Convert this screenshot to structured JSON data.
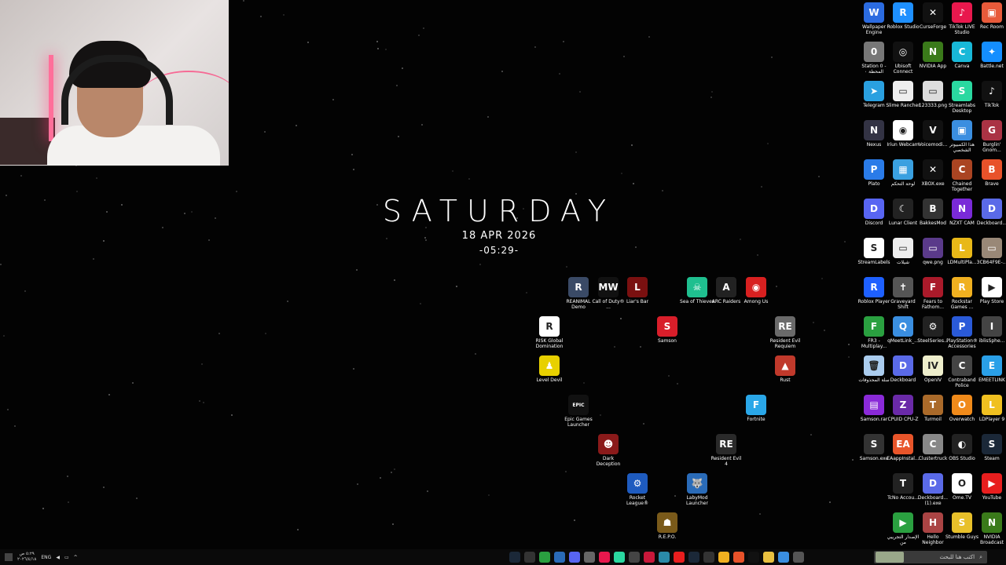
{
  "clock": {
    "day": "SATURDAY",
    "date": "18 APR 2026",
    "time": "-05:29-"
  },
  "taskbar": {
    "lang": "ENG",
    "time": "٥:٢٩ ص",
    "date": "٢٠٢٦/٤/١٨",
    "search_placeholder": "اكتب هنا للبحث"
  },
  "center_icons": [
    {
      "label": "REANIMAL Demo",
      "color": "#3a4a66",
      "glyph": "R"
    },
    {
      "label": "Call of Duty® ...",
      "color": "#111111",
      "glyph": "MW"
    },
    {
      "label": "Liar's Bar",
      "color": "#7a1010",
      "glyph": "L"
    },
    {
      "label": "Sea of Thieves",
      "color": "#1fbf8f",
      "glyph": "☠"
    },
    {
      "label": "ARC Raiders",
      "color": "#222222",
      "glyph": "A"
    },
    {
      "label": "Among Us",
      "color": "#d82020",
      "glyph": "◉"
    },
    {
      "label": "RISK Global Domination",
      "color": "#ffffff",
      "glyph": "R"
    },
    {
      "label": "Samson",
      "color": "#d81e2a",
      "glyph": "S"
    },
    {
      "label": "Resident Evil Requiem",
      "color": "#6a6a6a",
      "glyph": "RE"
    },
    {
      "label": "Level Devil",
      "color": "#e8d000",
      "glyph": "♟"
    },
    {
      "label": "Rust",
      "color": "#c0392b",
      "glyph": "▲"
    },
    {
      "label": "Epic Games Launcher",
      "color": "#111111",
      "glyph": "EPIC"
    },
    {
      "label": "Fortnite",
      "color": "#2aa7e8",
      "glyph": "F"
    },
    {
      "label": "Dark Deception",
      "color": "#8a1a1a",
      "glyph": "☻"
    },
    {
      "label": "Resident Evil 4",
      "color": "#2a2a2a",
      "glyph": "RE"
    },
    {
      "label": "Rocket League®",
      "color": "#1e5bbf",
      "glyph": "⚙"
    },
    {
      "label": "LabyMod Launcher",
      "color": "#2a6bb8",
      "glyph": "🐺"
    },
    {
      "label": "R.E.P.O.",
      "color": "#7a5a1a",
      "glyph": "☗"
    }
  ],
  "right_icons": [
    {
      "label": "Wallpaper Engine",
      "color": "#2b6be0",
      "glyph": "W"
    },
    {
      "label": "Roblox Studio",
      "color": "#1e90ff",
      "glyph": "R"
    },
    {
      "label": "CurseForge",
      "color": "#111111",
      "glyph": "✕"
    },
    {
      "label": "TikTok LIVE Studio",
      "color": "#e8184d",
      "glyph": "♪"
    },
    {
      "label": "Rec Room",
      "color": "#e85a3a",
      "glyph": "▣"
    },
    {
      "label": "Station 0 - المحطة ٠",
      "color": "#777777",
      "glyph": "0"
    },
    {
      "label": "Ubisoft Connect",
      "color": "#111111",
      "glyph": "◎"
    },
    {
      "label": "NVIDIA App",
      "color": "#3a7a1a",
      "glyph": "N"
    },
    {
      "label": "Canva",
      "color": "#18b8d8",
      "glyph": "C"
    },
    {
      "label": "Battle.net",
      "color": "#148eff",
      "glyph": "✦"
    },
    {
      "label": "Telegram",
      "color": "#2aa0e0",
      "glyph": "➤"
    },
    {
      "label": "Slime Rancher",
      "color": "#eeeeee",
      "glyph": "▭"
    },
    {
      "label": "123333.png",
      "color": "#dddddd",
      "glyph": "▭"
    },
    {
      "label": "Streamlabs Desktop",
      "color": "#2ad8a0",
      "glyph": "S"
    },
    {
      "label": "TikTok",
      "color": "#111111",
      "glyph": "♪"
    },
    {
      "label": "Nexus",
      "color": "#333344",
      "glyph": "N"
    },
    {
      "label": "Iriun Webcam",
      "color": "#ffffff",
      "glyph": "◉"
    },
    {
      "label": "Voicemodi...",
      "color": "#111111",
      "glyph": "V"
    },
    {
      "label": "هذا الكمبيوتر الشخصي",
      "color": "#3a8ee0",
      "glyph": "▣"
    },
    {
      "label": "Burglin' Gnom...",
      "color": "#aa3344",
      "glyph": "G"
    },
    {
      "label": "Plato",
      "color": "#2a7be8",
      "glyph": "P"
    },
    {
      "label": "لوحة التحكم",
      "color": "#3aa0e0",
      "glyph": "▦"
    },
    {
      "label": "XBOX.exe",
      "color": "#111111",
      "glyph": "✕"
    },
    {
      "label": "Chained Together",
      "color": "#aa4422",
      "glyph": "C"
    },
    {
      "label": "Brave",
      "color": "#e8522a",
      "glyph": "B"
    },
    {
      "label": "Discord",
      "color": "#5865f2",
      "glyph": "D"
    },
    {
      "label": "Lunar Client",
      "color": "#222222",
      "glyph": "☾"
    },
    {
      "label": "BakkesMod",
      "color": "#333333",
      "glyph": "B"
    },
    {
      "label": "NZXT CAM",
      "color": "#7a2ad8",
      "glyph": "N"
    },
    {
      "label": "Deckboard...",
      "color": "#5a6ae8",
      "glyph": "D"
    },
    {
      "label": "StreamLabels",
      "color": "#ffffff",
      "glyph": "S"
    },
    {
      "label": "شيلات",
      "color": "#eeeeee",
      "glyph": "▭"
    },
    {
      "label": "qwe.png",
      "color": "#5a3a8a",
      "glyph": "▭"
    },
    {
      "label": "LDMultiPla...",
      "color": "#e8b818",
      "glyph": "L"
    },
    {
      "label": "3CB64F9E-...",
      "color": "#998877",
      "glyph": "▭"
    },
    {
      "label": "Roblox Player",
      "color": "#1e60ff",
      "glyph": "R"
    },
    {
      "label": "Graveyard Shift",
      "color": "#555555",
      "glyph": "✝"
    },
    {
      "label": "Fears to Fathom...",
      "color": "#aa1a2a",
      "glyph": "F"
    },
    {
      "label": "Rockstar Games ...",
      "color": "#f0b020",
      "glyph": "R"
    },
    {
      "label": "Play Store",
      "color": "#ffffff",
      "glyph": "▶"
    },
    {
      "label": "FR3 - Multiplay...",
      "color": "#2aa040",
      "glyph": "F"
    },
    {
      "label": "qMeetLink_...",
      "color": "#3a8ee0",
      "glyph": "Q"
    },
    {
      "label": "SteelSeries...",
      "color": "#222222",
      "glyph": "⚙"
    },
    {
      "label": "PlayStation® Accessories",
      "color": "#2a5ad8",
      "glyph": "P"
    },
    {
      "label": "iblisSphe...",
      "color": "#444444",
      "glyph": "I"
    },
    {
      "label": "سلة المحذوفات",
      "color": "#aaccee",
      "glyph": "🗑"
    },
    {
      "label": "Deckboard",
      "color": "#5a6ae8",
      "glyph": "D"
    },
    {
      "label": "OpenIV",
      "color": "#eeeecc",
      "glyph": "IV"
    },
    {
      "label": "Contraband Police",
      "color": "#444444",
      "glyph": "C"
    },
    {
      "label": "EMEETLINK",
      "color": "#2aa0e8",
      "glyph": "E"
    },
    {
      "label": "Samson.rar",
      "color": "#8a2ad8",
      "glyph": "▤"
    },
    {
      "label": "CPUID CPU-Z",
      "color": "#6a2aa8",
      "glyph": "Z"
    },
    {
      "label": "Turmoil",
      "color": "#aa6a2a",
      "glyph": "T"
    },
    {
      "label": "Overwatch",
      "color": "#f08a1a",
      "glyph": "O"
    },
    {
      "label": "LDPlayer 9",
      "color": "#f0c020",
      "glyph": "L"
    },
    {
      "label": "Samson.exe",
      "color": "#333333",
      "glyph": "S"
    },
    {
      "label": "EAappInstal...",
      "color": "#e8552a",
      "glyph": "EA"
    },
    {
      "label": "Clustertruck",
      "color": "#888888",
      "glyph": "C"
    },
    {
      "label": "OBS Studio",
      "color": "#222222",
      "glyph": "◐"
    },
    {
      "label": "Steam",
      "color": "#1b2838",
      "glyph": "S"
    },
    {
      "label": "TcNo Accou...",
      "color": "#222222",
      "glyph": "T"
    },
    {
      "label": "Deckboard... (1).exe",
      "color": "#5a6ae8",
      "glyph": "D"
    },
    {
      "label": "Ome.TV",
      "color": "#ffffff",
      "glyph": "O"
    },
    {
      "label": "YouTube",
      "color": "#e81e1e",
      "glyph": "▶"
    },
    {
      "label": "الإصدار التجريبي من",
      "color": "#2aa040",
      "glyph": "▶"
    },
    {
      "label": "Hello Neighbor",
      "color": "#aa4444",
      "glyph": "H"
    },
    {
      "label": "Stumble Guys",
      "color": "#e8c02a",
      "glyph": "S"
    },
    {
      "label": "NVIDIA Broadcast",
      "color": "#3a7a1a",
      "glyph": "N"
    }
  ],
  "taskbar_apps": [
    {
      "name": "steam-taskbar-icon",
      "color": "#1b2838"
    },
    {
      "name": "obs-taskbar-icon",
      "color": "#333333"
    },
    {
      "name": "xbox-taskbar-icon",
      "color": "#2aa040"
    },
    {
      "name": "labymod-taskbar-icon",
      "color": "#2a6bb8"
    },
    {
      "name": "discord-taskbar-icon",
      "color": "#5865f2"
    },
    {
      "name": "chrome-dev-taskbar-icon",
      "color": "#666666"
    },
    {
      "name": "tiktok-taskbar-icon",
      "color": "#e8184d"
    },
    {
      "name": "streamlabs-taskbar-icon",
      "color": "#2ad8a0"
    },
    {
      "name": "curseforge-taskbar-icon",
      "color": "#444444"
    },
    {
      "name": "adobe-taskbar-icon",
      "color": "#c8183a"
    },
    {
      "name": "app-taskbar-icon",
      "color": "#2a8aa8"
    },
    {
      "name": "youtube-taskbar-icon",
      "color": "#e81e1e"
    },
    {
      "name": "steam2-taskbar-icon",
      "color": "#1b2838"
    },
    {
      "name": "epic-taskbar-icon",
      "color": "#333333"
    },
    {
      "name": "chrome-taskbar-icon",
      "color": "#f0b020"
    },
    {
      "name": "brave-taskbar-icon",
      "color": "#e8522a"
    },
    {
      "name": "tiktok2-taskbar-icon",
      "color": "#111111"
    },
    {
      "name": "folder-taskbar-icon",
      "color": "#e8c040"
    },
    {
      "name": "explorer-taskbar-icon",
      "color": "#3a8ee0"
    },
    {
      "name": "taskview-taskbar-icon",
      "color": "#555555"
    }
  ]
}
